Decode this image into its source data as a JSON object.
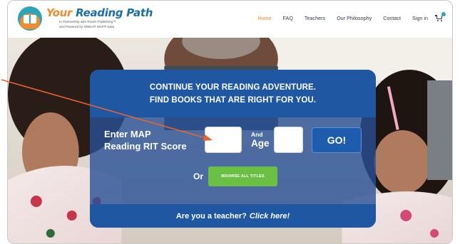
{
  "header": {
    "logo_title_your": "Your",
    "logo_title_rest": "Reading Path",
    "logo_sub_line1": "In Partnership with Rosen Publishing™",
    "logo_sub_line2": "and Powered by NWEA® MAP® Data",
    "nav": [
      {
        "label": "Home",
        "active": true
      },
      {
        "label": "FAQ",
        "active": false
      },
      {
        "label": "Teachers",
        "active": false
      },
      {
        "label": "Our Philosophy",
        "active": false
      },
      {
        "label": "Contact",
        "active": false
      },
      {
        "label": "Sign in",
        "active": false
      }
    ],
    "cart_icon": "cart-icon"
  },
  "card": {
    "heading_line1": "CONTINUE YOUR READING ADVENTURE.",
    "heading_line2": "FIND BOOKS THAT ARE RIGHT FOR YOU.",
    "rit_label": "Enter MAP\nReading RIT Score",
    "rit_value": "",
    "and_label": "And",
    "age_label": "Age",
    "age_value": "",
    "go_label": "GO!",
    "or_label": "Or",
    "browse_label": "BROWSE ALL TITLES",
    "teacher_question": "Are you a teacher?",
    "teacher_link": "Click here!"
  },
  "colors": {
    "brand_orange": "#f28b2c",
    "brand_blue": "#1c6fa8",
    "card_blue": "#1f57a3",
    "browse_green": "#6cbf45",
    "callout": "#e8642c"
  }
}
